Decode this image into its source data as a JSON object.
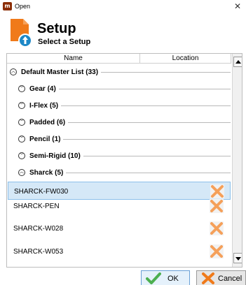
{
  "window": {
    "title": "Open",
    "app_icon": "app-logo-icon",
    "close_icon": "close-icon"
  },
  "header": {
    "title": "Setup",
    "subtitle": "Select a Setup",
    "icon": "document-upload-icon",
    "accent_color": "#f07a1a",
    "badge_color": "#1e88c7"
  },
  "grid": {
    "columns": [
      "Name",
      "Location"
    ],
    "groups": [
      {
        "label": "Default Master List (33)",
        "expanded": true,
        "level": 0
      },
      {
        "label": "Gear (4)",
        "expanded": false,
        "level": 1
      },
      {
        "label": "I-Flex (5)",
        "expanded": false,
        "level": 1
      },
      {
        "label": "Padded (6)",
        "expanded": false,
        "level": 1
      },
      {
        "label": "Pencil (1)",
        "expanded": false,
        "level": 1
      },
      {
        "label": "Semi-Rigid (10)",
        "expanded": false,
        "level": 1
      },
      {
        "label": "Sharck (5)",
        "expanded": true,
        "level": 1
      }
    ],
    "items": [
      {
        "name": "SHARCK-FW030",
        "location": "",
        "selected": true
      },
      {
        "name": "SHARCK-PEN",
        "location": "",
        "selected": false
      },
      {
        "name": "SHARCK-W028",
        "location": "",
        "selected": false
      },
      {
        "name": "SHARCK-W053",
        "location": "",
        "selected": false
      }
    ],
    "selection_color": "#d5e8f7"
  },
  "footer": {
    "ok_label": "OK",
    "cancel_label": "Cancel",
    "ok_icon": "checkmark-icon",
    "cancel_icon": "x-icon"
  }
}
